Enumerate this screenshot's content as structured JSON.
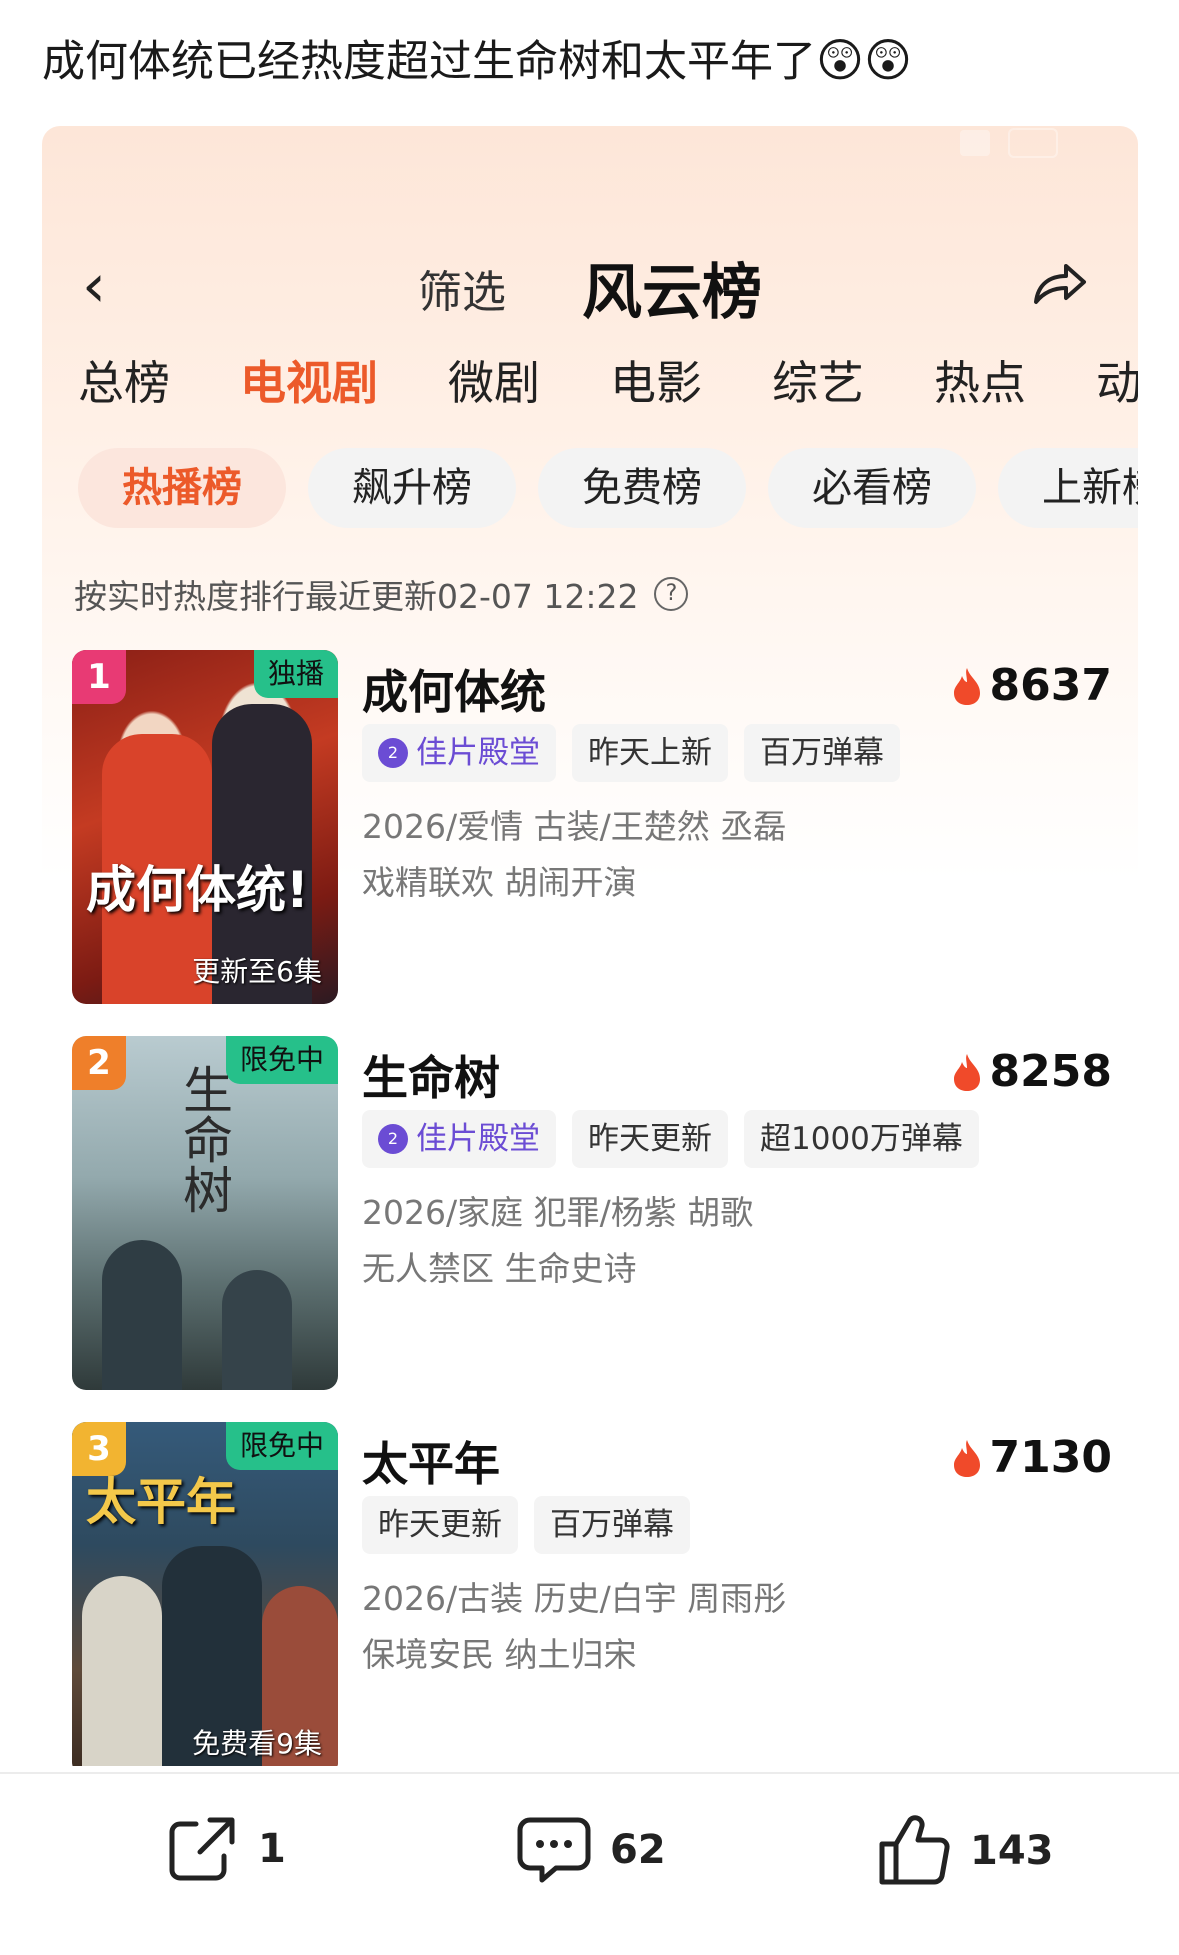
{
  "post": {
    "title": "成何体统已经热度超过生命树和太平年了",
    "emojis": "😲😲"
  },
  "screen": {
    "nav": {
      "back": "‹",
      "filter": "筛选",
      "title": "风云榜"
    },
    "category_tabs": [
      "总榜",
      "电视剧",
      "微剧",
      "电影",
      "综艺",
      "热点",
      "动"
    ],
    "active_category": "电视剧",
    "ranking_tabs": [
      "热播榜",
      "飙升榜",
      "免费榜",
      "必看榜",
      "上新榜"
    ],
    "active_ranking": "热播榜",
    "update_note": "按实时热度排行最近更新02-07 12:22",
    "help_icon": "?",
    "shows": [
      {
        "rank": "1",
        "corner": "独播",
        "title": "成何体统",
        "heat": "8637",
        "tags": [
          "佳片殿堂",
          "昨天上新",
          "百万弹幕"
        ],
        "meta": "2026/爱情 古装/王楚然 丞磊",
        "slogan": "戏精联欢 胡闹开演",
        "poster_title": "成何体统!",
        "poster_bottom": "更新至6集"
      },
      {
        "rank": "2",
        "corner": "限免中",
        "title": "生命树",
        "heat": "8258",
        "tags": [
          "佳片殿堂",
          "昨天更新",
          "超1000万弹幕"
        ],
        "meta": "2026/家庭 犯罪/杨紫 胡歌",
        "slogan": "无人禁区 生命史诗",
        "poster_title": "生命树",
        "poster_bottom": ""
      },
      {
        "rank": "3",
        "corner": "限免中",
        "title": "太平年",
        "heat": "7130",
        "tags": [
          "昨天更新",
          "百万弹幕"
        ],
        "meta": "2026/古装 历史/白宇 周雨彤",
        "slogan": "保境安民 纳土归宋",
        "poster_title": "太平年",
        "poster_bottom": "免费看9集"
      }
    ]
  },
  "actions": {
    "share_count": "1",
    "comment_count": "62",
    "like_count": "143"
  },
  "colors": {
    "accent": "#ec5a2a",
    "heat_flame": "#f04a2a",
    "brand_purple": "#6b4cd4",
    "free_tag": "#26c08a"
  }
}
